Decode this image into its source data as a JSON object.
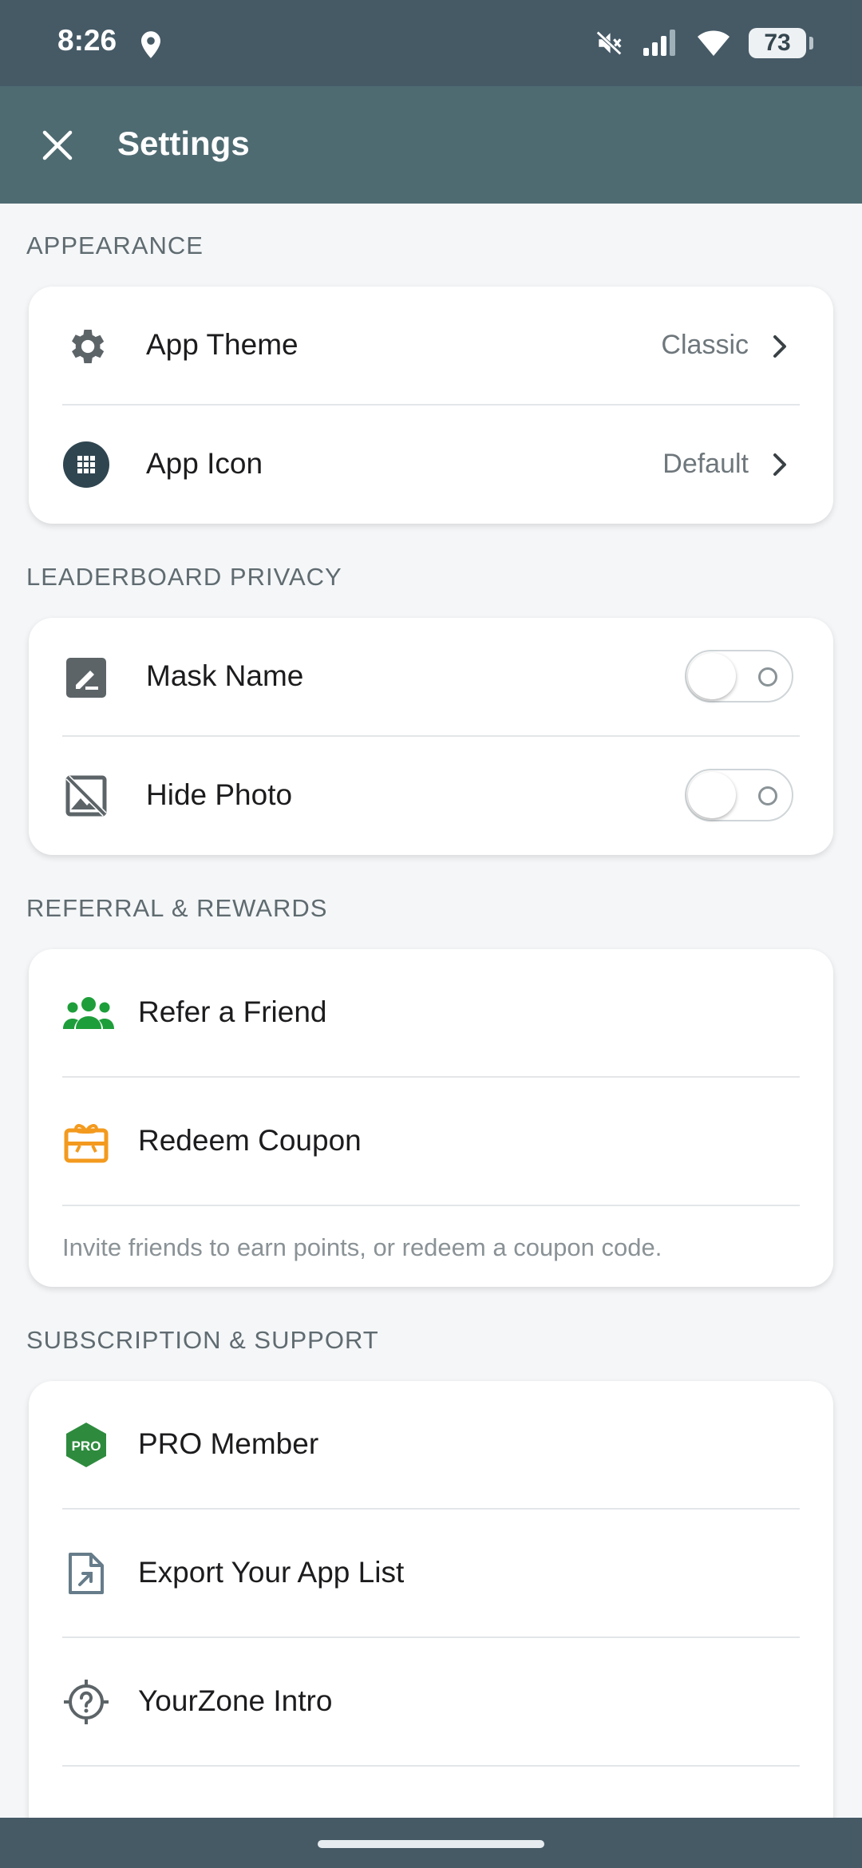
{
  "status_bar": {
    "time": "8:26",
    "battery": "73",
    "icons": [
      "location-icon",
      "mute-icon",
      "signal-icon",
      "wifi-icon",
      "battery-icon"
    ]
  },
  "app_bar": {
    "title": "Settings"
  },
  "sections": {
    "appearance": {
      "label": "APPEARANCE",
      "items": [
        {
          "label": "App Theme",
          "value": "Classic",
          "icon": "gear-icon"
        },
        {
          "label": "App Icon",
          "value": "Default",
          "icon": "grid-icon"
        }
      ]
    },
    "privacy": {
      "label": "LEADERBOARD PRIVACY",
      "items": [
        {
          "label": "Mask Name",
          "icon": "edit-icon",
          "enabled": false
        },
        {
          "label": "Hide Photo",
          "icon": "hide-image-icon",
          "enabled": false
        }
      ]
    },
    "referral": {
      "label": "REFERRAL & REWARDS",
      "items": [
        {
          "label": "Refer a Friend",
          "icon": "group-icon"
        },
        {
          "label": "Redeem Coupon",
          "icon": "gift-card-icon"
        }
      ],
      "note": "Invite friends to earn points, or redeem a coupon code."
    },
    "support": {
      "label": "SUBSCRIPTION & SUPPORT",
      "items": [
        {
          "label": "PRO Member",
          "icon": "pro-badge-icon",
          "badge": "PRO"
        },
        {
          "label": "Export Your App List",
          "icon": "export-file-icon"
        },
        {
          "label": "YourZone Intro",
          "icon": "help-target-icon"
        }
      ]
    }
  },
  "colors": {
    "status_bar": "#465a66",
    "app_bar": "#4f6b72",
    "background": "#f4f6f8",
    "green": "#1e9e3a",
    "orange": "#f39a1e",
    "pro_green": "#2e8b3e"
  }
}
